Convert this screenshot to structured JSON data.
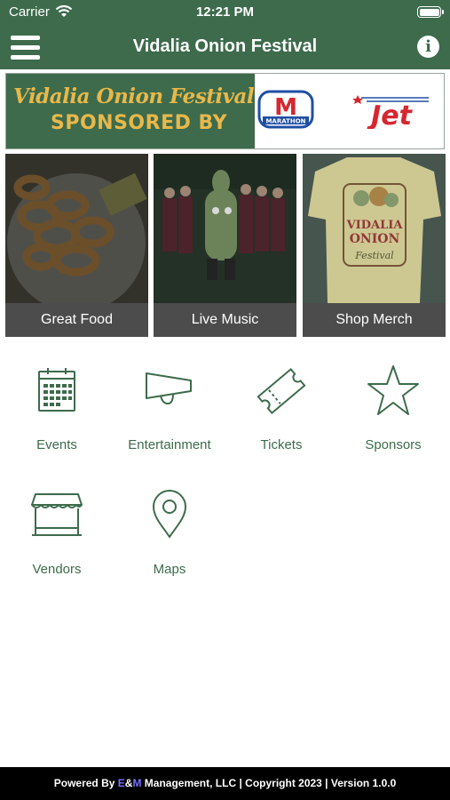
{
  "status_bar": {
    "carrier": "Carrier",
    "time": "12:21 PM"
  },
  "nav": {
    "title": "Vidalia Onion Festival",
    "menu_icon": "hamburger-menu-icon",
    "info_icon": "info-icon",
    "info_glyph": "i"
  },
  "banner": {
    "script_title": "Vidalia Onion Festival",
    "sponsored_text": "SPONSORED BY",
    "sponsor_1_logo": "MARATHON",
    "sponsor_1_glyph": "M",
    "sponsor_2_logo": "Jet"
  },
  "tiles": [
    {
      "label": "Great Food"
    },
    {
      "label": "Live Music"
    },
    {
      "label": "Shop Merch"
    }
  ],
  "merch_shirt_text": {
    "line1": "VIDALIA",
    "line2": "ONION",
    "line3": "Festival"
  },
  "menu_items": [
    {
      "label": "Events",
      "icon": "calendar-icon"
    },
    {
      "label": "Entertainment",
      "icon": "megaphone-icon"
    },
    {
      "label": "Tickets",
      "icon": "ticket-icon"
    },
    {
      "label": "Sponsors",
      "icon": "star-icon"
    },
    {
      "label": "Vendors",
      "icon": "storefront-icon"
    },
    {
      "label": "Maps",
      "icon": "map-pin-icon"
    }
  ],
  "footer": {
    "prefix": "Powered By ",
    "em_e": "E",
    "em_amp": "&",
    "em_m": "M",
    "suffix": " Management, LLC | Copyright 2023 | Version 1.0.0"
  },
  "colors": {
    "brand_green": "#3d6b4c",
    "banner_gold": "#e8b84a",
    "tile_label_bg": "#4c4c4c",
    "footer_bg": "#000000"
  }
}
